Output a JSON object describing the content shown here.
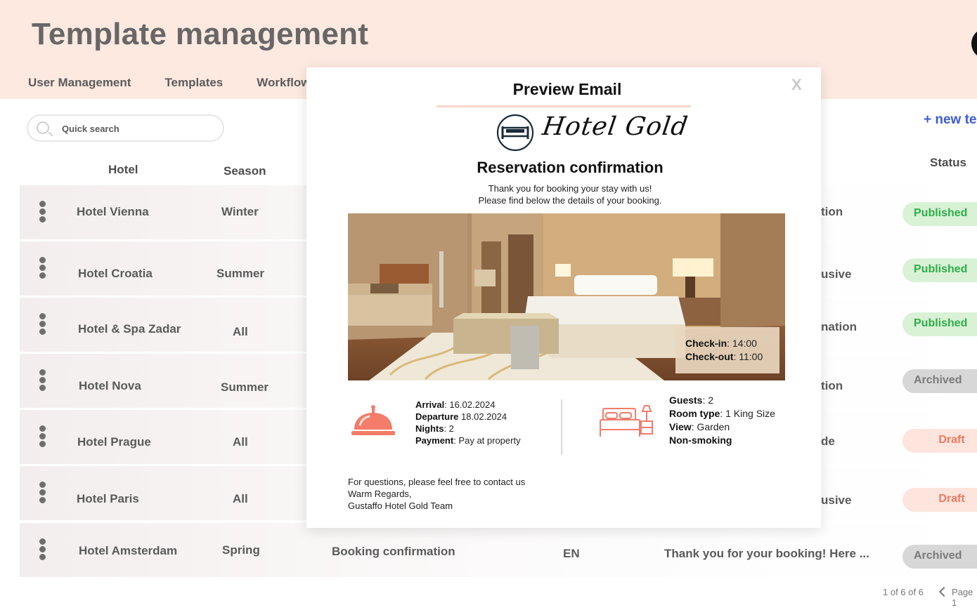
{
  "page": {
    "title": "Template management"
  },
  "nav": {
    "items": [
      "User Management",
      "Templates",
      "Workflow"
    ]
  },
  "search": {
    "placeholder": "Quick search"
  },
  "toolbar": {
    "new_template_label": "+ new template"
  },
  "table": {
    "headers": {
      "hotel": "Hotel",
      "season": "Season",
      "status": "Status"
    },
    "rows": [
      {
        "hotel": "Hotel  Vienna",
        "season": "Winter",
        "type_fragment": "tion",
        "status": "Published"
      },
      {
        "hotel": "Hotel Croatia",
        "season": "Summer",
        "type_fragment": "usive",
        "status": "Published"
      },
      {
        "hotel": "Hotel & Spa Zadar",
        "season": "All",
        "type_fragment": "nation",
        "status": "Published"
      },
      {
        "hotel": "Hotel Nova",
        "season": "Summer",
        "type_fragment": "tion",
        "status": "Archived"
      },
      {
        "hotel": "Hotel  Prague",
        "season": "All",
        "type_fragment": "de",
        "status": "Draft"
      },
      {
        "hotel": "Hotel  Paris",
        "season": "All",
        "type_fragment": "usive",
        "status": "Draft"
      },
      {
        "hotel": "Hotel  Amsterdam",
        "season": "Spring",
        "template": "Booking confirmation",
        "language": "EN",
        "subject": "Thank you for your booking! Here ...",
        "status": "Archived"
      }
    ]
  },
  "pagination": {
    "count": "1 of 6 of 6",
    "page_label": "Page 1"
  },
  "modal": {
    "title": "Preview Email",
    "close_label": "X",
    "logo_text": "Hotel Gold",
    "heading": "Reservation confirmation",
    "intro_line1": "Thank you for booking your stay with us!",
    "intro_line2": "Please find below the details of your booking.",
    "checkin": {
      "checkin_label": "Check-in",
      "checkin_value": ": 14:00",
      "checkout_label": "Check-out",
      "checkout_value": ": 11:00"
    },
    "booking": {
      "arrival_label": "Arrival",
      "arrival_value": ": 16.02.2024",
      "departure_label": "Departure",
      "departure_value": " 18.02.2024",
      "nights_label": "Nights",
      "nights_value": ": 2",
      "payment_label": "Payment",
      "payment_value": ": Pay at property"
    },
    "room": {
      "guests_label": "Guests",
      "guests_value": ": 2",
      "room_type_label": "Room type",
      "room_type_value": ": 1 King Size",
      "view_label": "View",
      "view_value": ": Garden",
      "smoking_label": "Non-smoking"
    },
    "closing_line1": "For questions, please feel free to contact us",
    "closing_line2": "Warm Regards,",
    "closing_line3": "Gustaffo Hotel Gold Team"
  },
  "colors": {
    "header_bg": "#fde9e0",
    "accent_blue": "#3b5bdb",
    "icon_coral": "#f47c6a",
    "published": "#2fae4a",
    "draft": "#f07b63"
  }
}
